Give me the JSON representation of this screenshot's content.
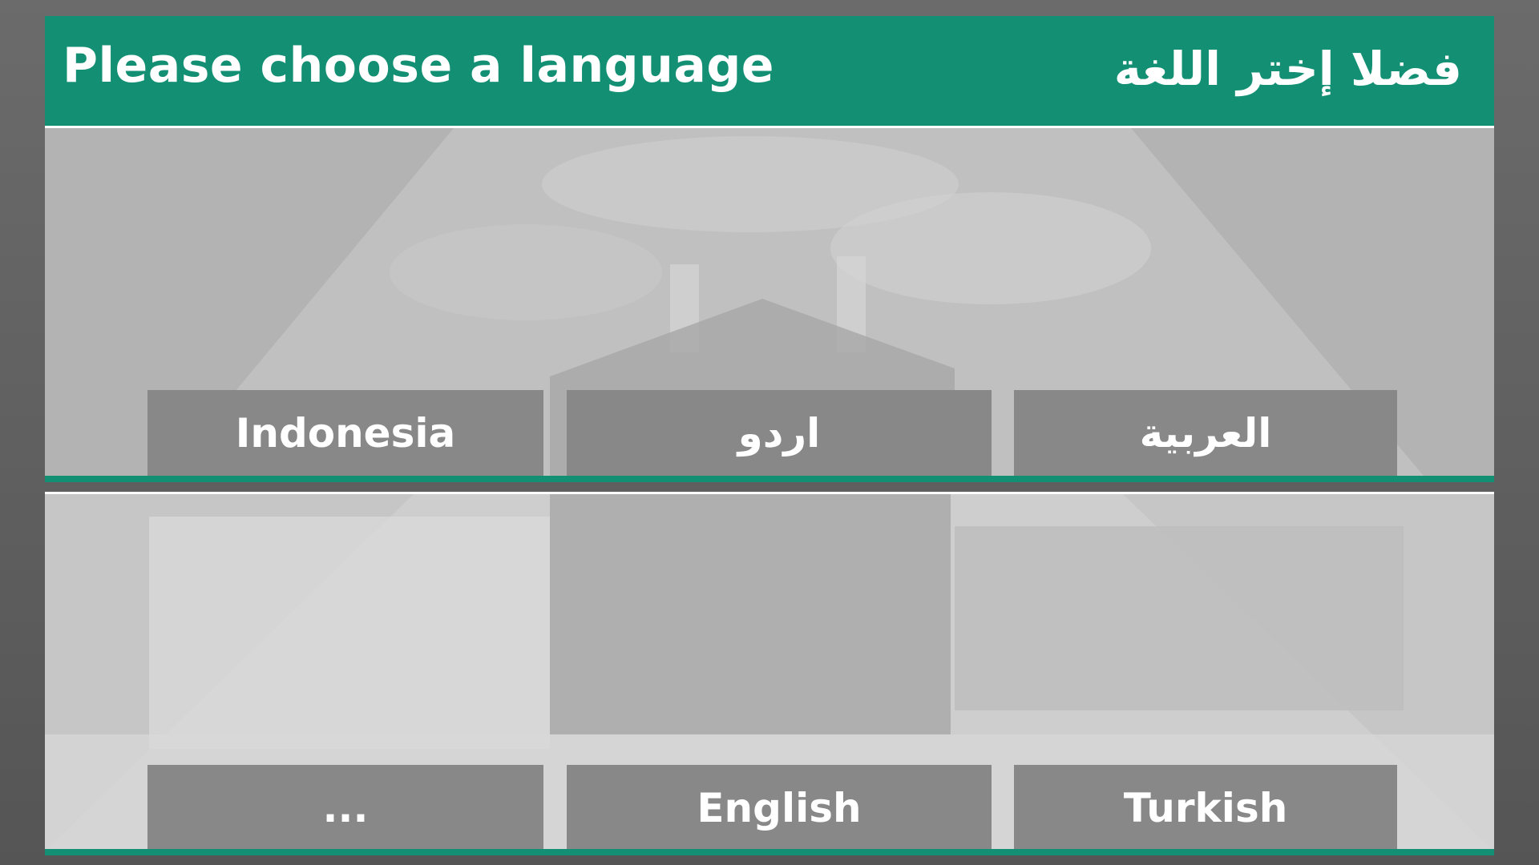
{
  "header": {
    "title_en": "Please choose a language",
    "title_ar": "فضلا إختر اللغة"
  },
  "languages_row1": [
    {
      "label": "Indonesia"
    },
    {
      "label": "اردو"
    },
    {
      "label": "العربية"
    }
  ],
  "languages_row2": [
    {
      "label": "..."
    },
    {
      "label": "English"
    },
    {
      "label": "Turkish"
    }
  ],
  "colors": {
    "accent": "#138f74",
    "button_bg": "#888888",
    "text": "#ffffff"
  }
}
